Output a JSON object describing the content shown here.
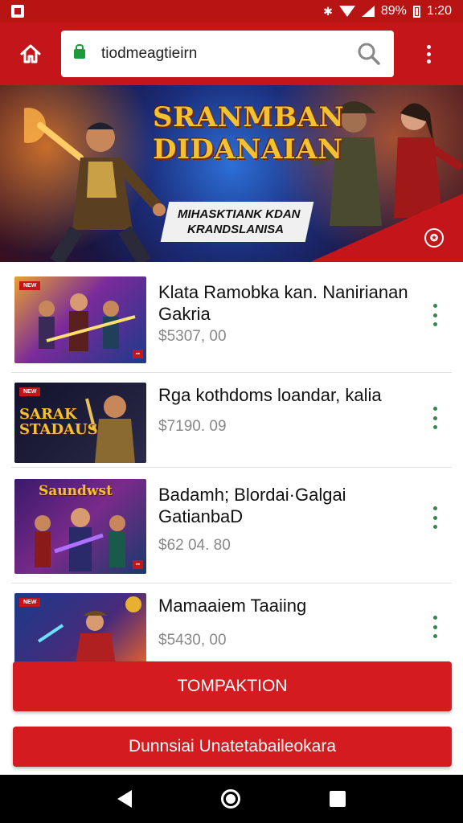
{
  "status_bar": {
    "battery": "89%",
    "time": "1:20"
  },
  "browser": {
    "url": "tiodmeagtieirn",
    "home_icon": "home-icon",
    "search_icon": "search-icon",
    "menu_icon": "more-vertical-icon"
  },
  "banner": {
    "title_line1": "SRANMBAN",
    "title_line2": "DIDANAIAN",
    "tagline_line1": "MIHASKTIANK KDAN",
    "tagline_line2": "KRANDSLANISA"
  },
  "items": [
    {
      "title": "Klata Ramobka kan. Nanirianan Gakria",
      "price": "$5307, 00",
      "thumb_badge": "NEW",
      "thumb_title": ""
    },
    {
      "title": "Rga kothdoms loandar, kalia",
      "price": "$7190. 09",
      "thumb_badge": "NEW",
      "thumb_title": "SARAK STADAUS"
    },
    {
      "title": "Badamh; Blordai·Galgai GatianbaD",
      "price": "$62 04. 80",
      "thumb_badge": "",
      "thumb_title": "Saundwst"
    },
    {
      "title": "Mamaaiem Taaiing",
      "price": "$5430, 00",
      "thumb_badge": "NEW",
      "thumb_title": ""
    }
  ],
  "actions": {
    "primary_label": "TOMPAKTION",
    "secondary_label": "Dunnsiai Unatetabaileokara"
  },
  "colors": {
    "brand_red": "#c4161a",
    "button_red": "#d41c20",
    "more_green": "#2e8b4e",
    "banner_gold": "#f2c230"
  }
}
